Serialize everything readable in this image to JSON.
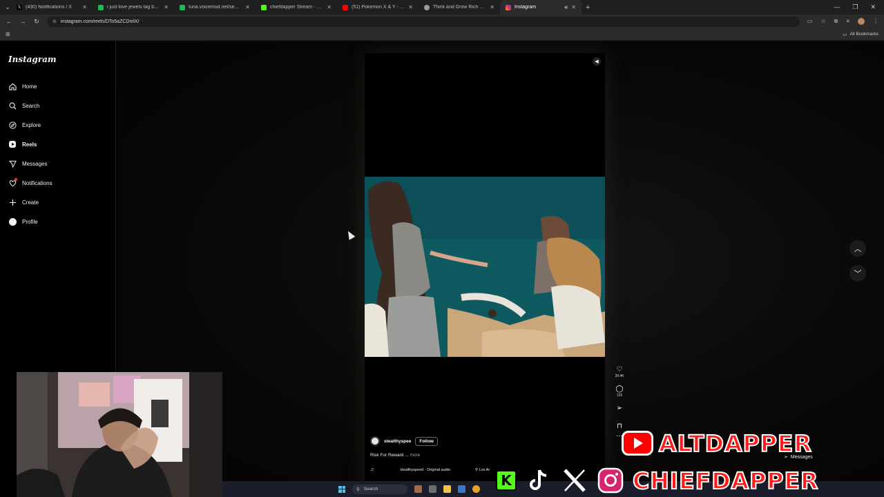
{
  "browser": {
    "tabs": [
      {
        "label": "(430) Notifications / X",
        "favicon": "x-icon",
        "color": "#000000",
        "active": false
      },
      {
        "label": "i just love jewels tag by money",
        "favicon": "voicemod-icon",
        "color": "#1db954",
        "active": false
      },
      {
        "label": "tuna.voicemod.net/search/sou",
        "favicon": "voicemod-icon",
        "color": "#1db954",
        "active": false
      },
      {
        "label": "chiefdapper Stream - Watch",
        "favicon": "kick-icon",
        "color": "#53fc18",
        "active": false
      },
      {
        "label": "(51) Pokemon X & Y - Gate The",
        "favicon": "youtube-icon",
        "color": "#ff0000",
        "active": false
      },
      {
        "label": "Think and Grow Rich by Napole",
        "favicon": "globe-icon",
        "color": "#9e9e9e",
        "active": false
      },
      {
        "label": "Instagram",
        "favicon": "instagram-icon",
        "color": "#e1306c",
        "active": true
      }
    ],
    "url": "instagram.com/reels/DTo5aZCDmlX/",
    "all_bookmarks": "All Bookmarks"
  },
  "instagram": {
    "logo": "Instagram",
    "nav": [
      {
        "label": "Home",
        "icon": "home-icon"
      },
      {
        "label": "Search",
        "icon": "search-icon"
      },
      {
        "label": "Explore",
        "icon": "compass-icon"
      },
      {
        "label": "Reels",
        "icon": "reels-icon"
      },
      {
        "label": "Messages",
        "icon": "send-icon"
      },
      {
        "label": "Notifications",
        "icon": "heart-icon"
      },
      {
        "label": "Create",
        "icon": "plus-icon"
      },
      {
        "label": "Profile",
        "icon": "profile-icon"
      }
    ],
    "reel": {
      "author": "stealthyspee",
      "follow_label": "Follow",
      "caption": "Risk For Reward ...",
      "more_label": "more",
      "audio": "stealthyspeed · Original audio",
      "location": "Los Ar",
      "likes": "39.4K",
      "comments": "133"
    }
  },
  "overlay": {
    "brand_top": "ALTDAPPER",
    "brand_bottom": "CHIEFDAPPER",
    "messages_label": "Messages",
    "taskbar_search": "Search"
  }
}
